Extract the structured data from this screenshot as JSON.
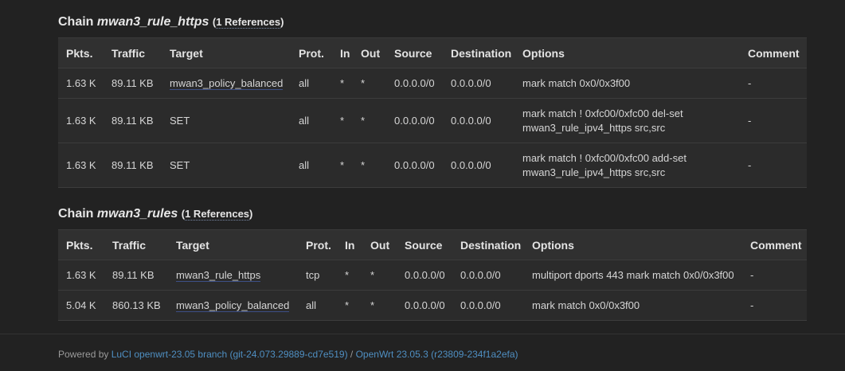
{
  "chain1": {
    "prefix": "Chain",
    "name": "mwan3_rule_https",
    "refs": "1 References",
    "headers": [
      "Pkts.",
      "Traffic",
      "Target",
      "Prot.",
      "In",
      "Out",
      "Source",
      "Destination",
      "Options",
      "Comment"
    ],
    "rows": [
      {
        "pkts": "1.63 K",
        "traffic": "89.11 KB",
        "target": "mwan3_policy_balanced",
        "prot": "all",
        "in": "*",
        "out": "*",
        "source": "0.0.0.0/0",
        "destination": "0.0.0.0/0",
        "options1": "mark match 0x0/0x3f00",
        "options2": "",
        "comment": "-"
      },
      {
        "pkts": "1.63 K",
        "traffic": "89.11 KB",
        "target": "SET",
        "prot": "all",
        "in": "*",
        "out": "*",
        "source": "0.0.0.0/0",
        "destination": "0.0.0.0/0",
        "options1": "mark match ! 0xfc00/0xfc00 del-set",
        "options2": "mwan3_rule_ipv4_https src,src",
        "comment": "-"
      },
      {
        "pkts": "1.63 K",
        "traffic": "89.11 KB",
        "target": "SET",
        "prot": "all",
        "in": "*",
        "out": "*",
        "source": "0.0.0.0/0",
        "destination": "0.0.0.0/0",
        "options1": "mark match ! 0xfc00/0xfc00 add-set",
        "options2": "mwan3_rule_ipv4_https src,src",
        "comment": "-"
      }
    ]
  },
  "chain2": {
    "prefix": "Chain",
    "name": "mwan3_rules",
    "refs": "1 References",
    "headers": [
      "Pkts.",
      "Traffic",
      "Target",
      "Prot.",
      "In",
      "Out",
      "Source",
      "Destination",
      "Options",
      "Comment"
    ],
    "rows": [
      {
        "pkts": "1.63 K",
        "traffic": "89.11 KB",
        "target": "mwan3_rule_https",
        "prot": "tcp",
        "in": "*",
        "out": "*",
        "source": "0.0.0.0/0",
        "destination": "0.0.0.0/0",
        "options": "multiport dports 443 mark match 0x0/0x3f00",
        "comment": "-"
      },
      {
        "pkts": "5.04 K",
        "traffic": "860.13 KB",
        "target": "mwan3_policy_balanced",
        "prot": "all",
        "in": "*",
        "out": "*",
        "source": "0.0.0.0/0",
        "destination": "0.0.0.0/0",
        "options": "mark match 0x0/0x3f00",
        "comment": "-"
      }
    ]
  },
  "footer": {
    "powered_by": "Powered by ",
    "luci_link": "LuCI openwrt-23.05 branch (git-24.073.29889-cd7e519)",
    "separator": " / ",
    "openwrt_link": "OpenWrt 23.05.3 (r23809-234f1a2efa)"
  }
}
